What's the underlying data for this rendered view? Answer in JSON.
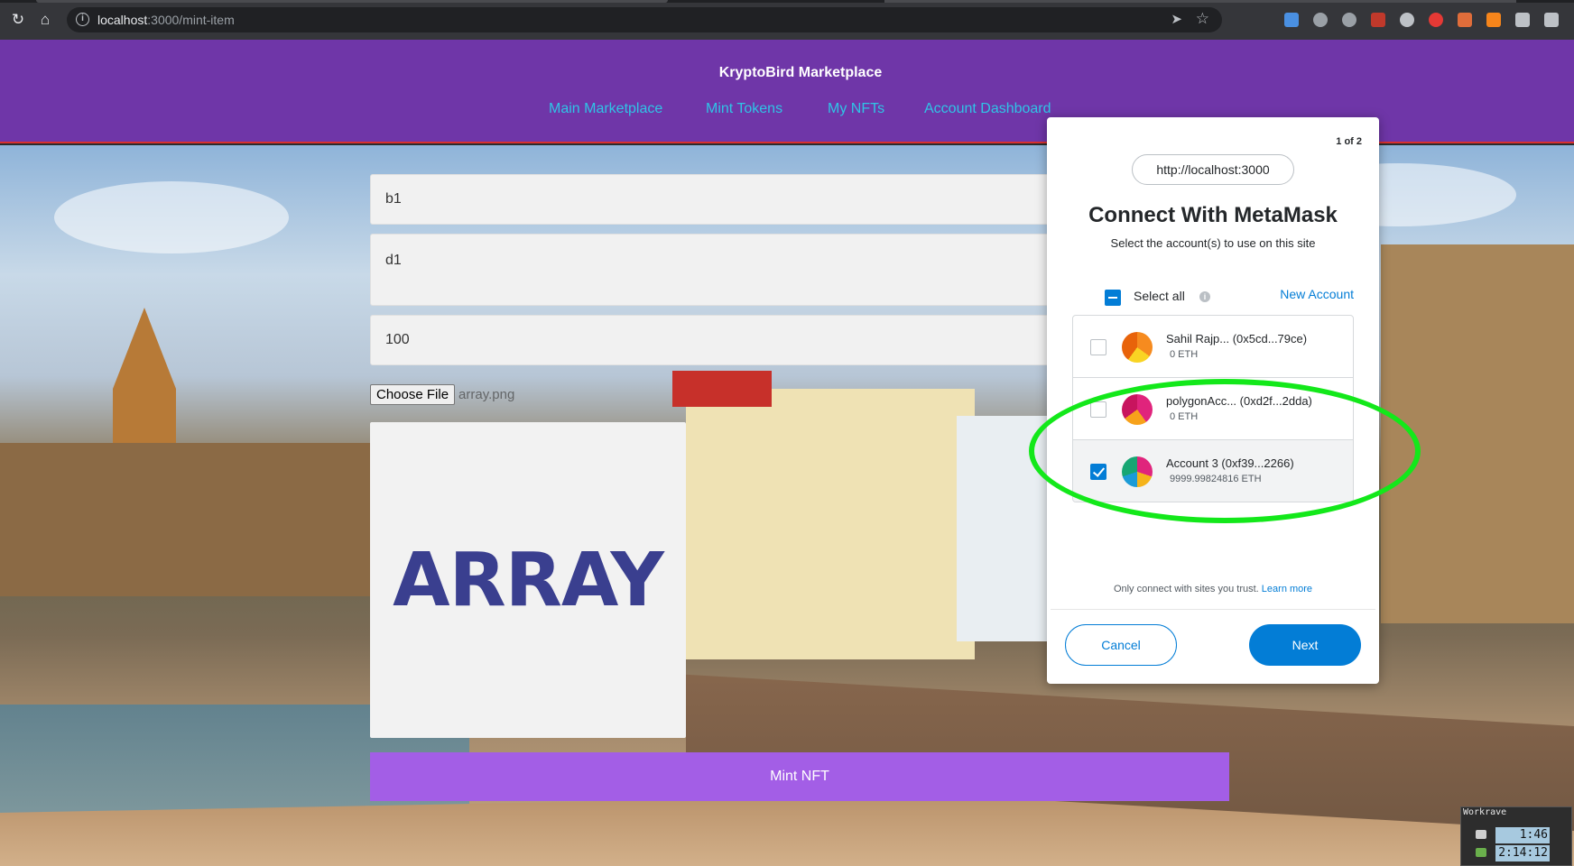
{
  "browser": {
    "url_host": "localhost",
    "url_path": ":3000/mint-item"
  },
  "site": {
    "brand": "KryptoBird Marketplace",
    "nav": [
      "Main Marketplace",
      "Mint Tokens",
      "My NFTs",
      "Account Dashboard"
    ]
  },
  "form": {
    "name_value": "b1",
    "description_value": "d1",
    "price_value": "100",
    "choose_file_label": "Choose File",
    "file_name": "array.png",
    "preview_text": "ARRAY",
    "mint_label": "Mint NFT"
  },
  "metamask": {
    "page_indicator": "1 of 2",
    "origin": "http://localhost:3000",
    "title": "Connect With MetaMask",
    "subtitle": "Select the account(s) to use on this site",
    "select_all": "Select all",
    "new_account": "New Account",
    "accounts": [
      {
        "name": "Sahil Rajp... (0x5cd...79ce)",
        "balance": "0 ETH",
        "selected": false
      },
      {
        "name": "polygonAcc... (0xd2f...2dda)",
        "balance": "0 ETH",
        "selected": false
      },
      {
        "name": "Account 3 (0xf39...2266)",
        "balance": "9999.99824816 ETH",
        "selected": true
      }
    ],
    "trust_note": "Only connect with sites you trust.",
    "learn_more": "Learn more",
    "cancel": "Cancel",
    "next": "Next"
  },
  "workrave": {
    "title": "Workrave",
    "micro_break": "1:46",
    "daily_limit": "2:14:12"
  },
  "colors": {
    "navbar": "#6f36a8",
    "nav_link": "#2fc4e6",
    "mint_button": "#a35ee6",
    "metamask_blue": "#037dd6",
    "highlight": "#13e81a"
  }
}
